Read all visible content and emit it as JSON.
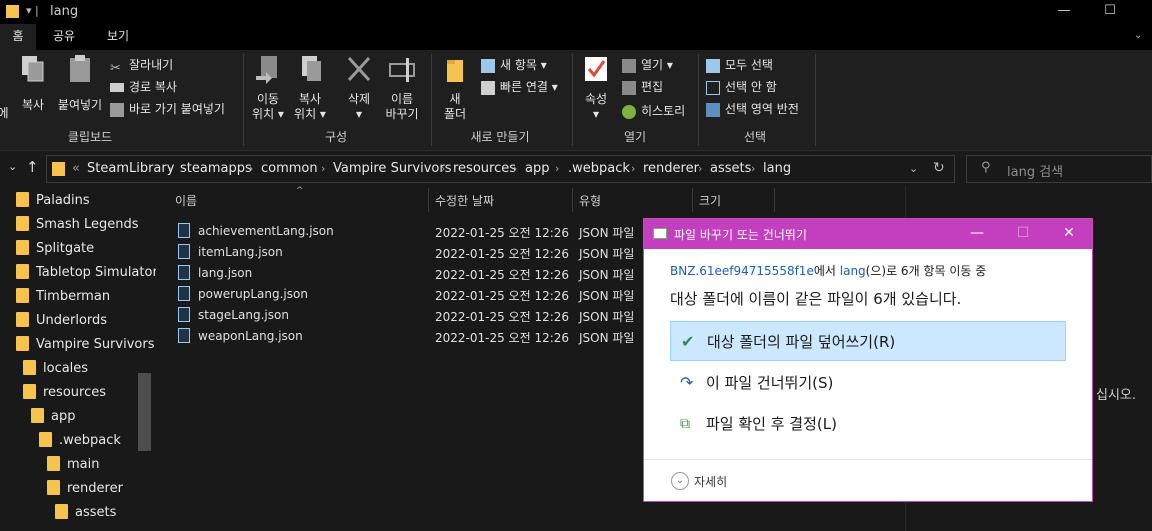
{
  "window": {
    "title": "lang",
    "minimize_glyph": "—",
    "maximize_glyph": "☐"
  },
  "ribbon_tabs": [
    "홈",
    "공유",
    "보기"
  ],
  "ribbon": {
    "clipboard": {
      "group_label": "클립보드",
      "pin_label_partial": "에",
      "copy_label": "복사",
      "paste_label": "붙여넣기",
      "cut_label": "잘라내기",
      "copy_path_label": "경로 복사",
      "paste_shortcut_label": "바로 가기 붙여넣기"
    },
    "organize": {
      "group_label": "구성",
      "move_to_label": [
        "이동",
        "위치 ▾"
      ],
      "copy_to_label": [
        "복사",
        "위치 ▾"
      ],
      "delete_label": [
        "삭제",
        "▾"
      ],
      "rename_label": [
        "이름",
        "바꾸기"
      ]
    },
    "new": {
      "group_label": "새로 만들기",
      "new_folder_label": [
        "새",
        "폴더"
      ],
      "new_item_label": "새 항목 ▾",
      "easy_access_label": "빠른 연결 ▾"
    },
    "open": {
      "group_label": "열기",
      "properties_label": [
        "속성",
        "▾"
      ],
      "open_label": "열기 ▾",
      "edit_label": "편집",
      "history_label": "히스토리"
    },
    "select": {
      "group_label": "선택",
      "select_all_label": "모두 선택",
      "select_none_label": "선택 안 함",
      "invert_selection_label": "선택 영역 반전"
    }
  },
  "address": {
    "overflow": "«",
    "crumbs": [
      "SteamLibrary",
      "steamapps",
      "common",
      "Vampire Survivors",
      "resources",
      "app",
      ".webpack",
      "renderer",
      "assets",
      "lang"
    ],
    "search_placeholder": "lang 검색"
  },
  "nav_pane": {
    "items": [
      {
        "label": "Paladins"
      },
      {
        "label": "Smash Legends"
      },
      {
        "label": "Splitgate"
      },
      {
        "label": "Tabletop Simulator"
      },
      {
        "label": "Timberman"
      },
      {
        "label": "Underlords"
      },
      {
        "label": "Vampire Survivors"
      },
      {
        "label": "locales"
      },
      {
        "label": "resources"
      },
      {
        "label": "app"
      },
      {
        "label": ".webpack"
      },
      {
        "label": "main"
      },
      {
        "label": "renderer"
      },
      {
        "label": "assets"
      }
    ]
  },
  "file_list": {
    "columns": [
      "이름",
      "수정한 날짜",
      "유형",
      "크기"
    ],
    "rows": [
      {
        "name": "achievementLang.json",
        "date": "2022-01-25 오전 12:26",
        "type": "JSON 파일"
      },
      {
        "name": "itemLang.json",
        "date": "2022-01-25 오전 12:26",
        "type": "JSON 파일"
      },
      {
        "name": "lang.json",
        "date": "2022-01-25 오전 12:26",
        "type": "JSON 파일"
      },
      {
        "name": "powerupLang.json",
        "date": "2022-01-25 오전 12:26",
        "type": "JSON 파일"
      },
      {
        "name": "stageLang.json",
        "date": "2022-01-25 오전 12:26",
        "type": "JSON 파일"
      },
      {
        "name": "weaponLang.json",
        "date": "2022-01-25 오전 12:26",
        "type": "JSON 파일"
      }
    ]
  },
  "preview_pane": {
    "hint_partial": "십시오."
  },
  "dialog": {
    "title": "파일 바꾸기 또는 건너뛰기",
    "source_name": "BNZ.61eef94715558f1e",
    "source_mid": "에서",
    "dest_name": "lang",
    "source_tail": "(으)로 6개 항목 이동 중",
    "headline": "대상 폴더에 이름이 같은 파일이 6개 있습니다.",
    "option_replace": "대상 폴더의 파일 덮어쓰기(R)",
    "option_skip": "이 파일 건너뛰기(S)",
    "option_decide": "파일 확인 후 결정(L)",
    "more_details": "자세히"
  },
  "colors": {
    "dialog_title_bg": "#c33fbf",
    "folder_yellow": "#f6c44e",
    "selected_option_bg": "#cce8ff",
    "link_blue": "#1a5fb4"
  }
}
